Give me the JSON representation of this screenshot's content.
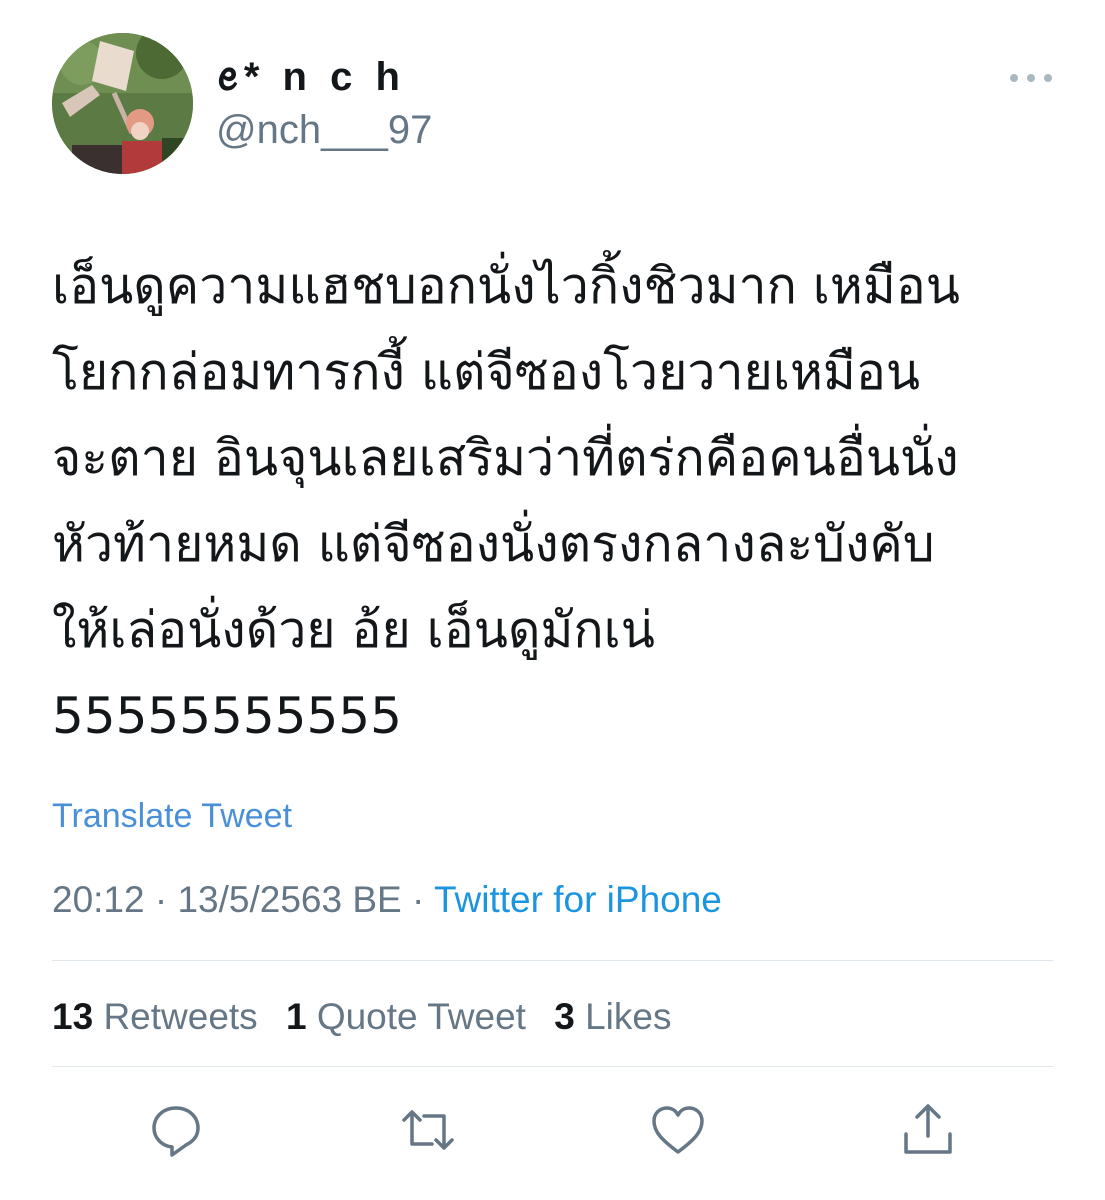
{
  "tweet": {
    "display_name": "ꫀ* n c h",
    "handle": "@nch___97",
    "text": "เอ็นดูความแฮชบอกนั่งไวกิ้งชิวมาก เหมือน\nโยกกล่อมทารกงี้ แต่จีซองโวยวายเหมือน\nจะตาย อินจุนเลยเสริมว่าที่ตร่กคือคนอื่นนั่ง\nหัวท้ายหมด แต่จีซองนั่งตรงกลางละบังคับ\nให้เล่อนั่งด้วย อ้ย เอ็นดูมักเน่\n55555555555",
    "translate_label": "Translate Tweet",
    "time": "20:12",
    "date": "13/5/2563 BE",
    "separator": "·",
    "source": "Twitter for iPhone",
    "stats": {
      "retweets_count": "13",
      "retweets_label": "Retweets",
      "quotes_count": "1",
      "quotes_label": "Quote Tweet",
      "likes_count": "3",
      "likes_label": "Likes"
    }
  },
  "icons": {
    "more": "more-horizontal-icon",
    "reply": "reply-icon",
    "retweet": "retweet-icon",
    "like": "heart-icon",
    "share": "share-icon"
  },
  "colors": {
    "primary_text": "#14171a",
    "secondary_text": "#657786",
    "link": "#1b95e0",
    "translate": "#4a90d9",
    "divider": "#e1e8ed",
    "icon": "#657786"
  }
}
